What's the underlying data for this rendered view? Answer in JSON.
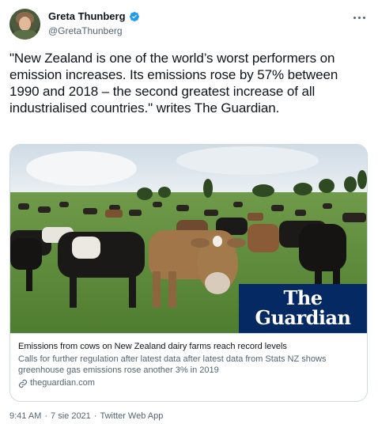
{
  "author": {
    "display_name": "Greta Thunberg",
    "handle": "@GretaThunberg",
    "verified_icon": "verified-badge-icon",
    "avatar_icon": "avatar"
  },
  "tweet": {
    "text": "\"New Zealand is one of the world’s worst performers on emission increases. Its emissions rose by 57% between 1990 and 2018 – the second greatest increase of all industrialised countries.\" writes The Guardian."
  },
  "card": {
    "logo_line1": "The",
    "logo_line2": "Guardian",
    "title": "Emissions from cows on New Zealand dairy farms reach record levels",
    "description": "Calls for further regulation after latest data after latest data from Stats NZ shows greenhouse gas emissions rose another 3% in 2019",
    "domain": "theguardian.com"
  },
  "footer": {
    "time": "9:41 AM",
    "separator": "·",
    "date": "7 sie 2021",
    "separator2": "·",
    "app": "Twitter Web App"
  },
  "colors": {
    "accent": "#1d9bf0",
    "guardian_blue": "#052962",
    "text_secondary": "#536471"
  }
}
